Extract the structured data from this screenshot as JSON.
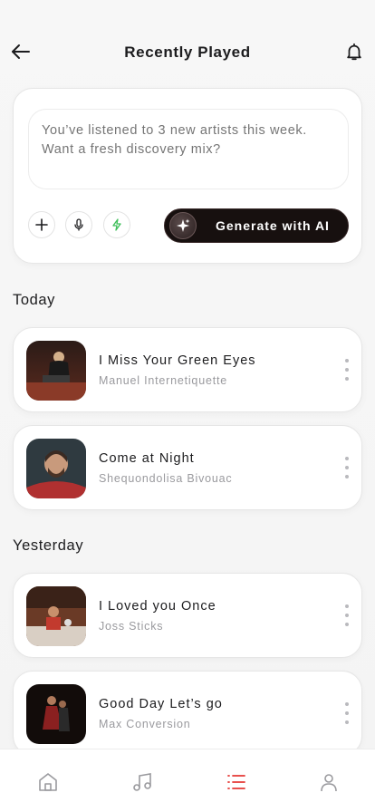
{
  "header": {
    "title": "Recently Played",
    "back_icon": "arrow-left-icon",
    "notification_icon": "bell-icon"
  },
  "ai_prompt": {
    "placeholder": "You’ve listened to 3 new artists this week. Want a fresh discovery mix?",
    "tools": [
      "plus-icon",
      "microphone-icon",
      "lightning-icon"
    ],
    "generate_label": "Generate with AI",
    "generate_icon": "sparkle-icon"
  },
  "sections": [
    {
      "title": "Today",
      "tracks": [
        {
          "title": "I Miss Your Green Eyes",
          "artist": "Manuel Internetiquette"
        },
        {
          "title": "Come at Night",
          "artist": "Shequondolisa Bivouac"
        }
      ]
    },
    {
      "title": "Yesterday",
      "tracks": [
        {
          "title": "I Loved you Once",
          "artist": "Joss Sticks"
        },
        {
          "title": "Good Day Let’s go",
          "artist": "Max Conversion"
        }
      ]
    }
  ],
  "bottom_nav": {
    "items": [
      "home-icon",
      "music-icon",
      "list-icon",
      "profile-icon"
    ],
    "active_index": 2
  },
  "colors": {
    "accent": "#e53935",
    "button_dark": "#17100f",
    "lightning_green": "#3fbf5a",
    "muted_text": "#9a9a9e"
  }
}
